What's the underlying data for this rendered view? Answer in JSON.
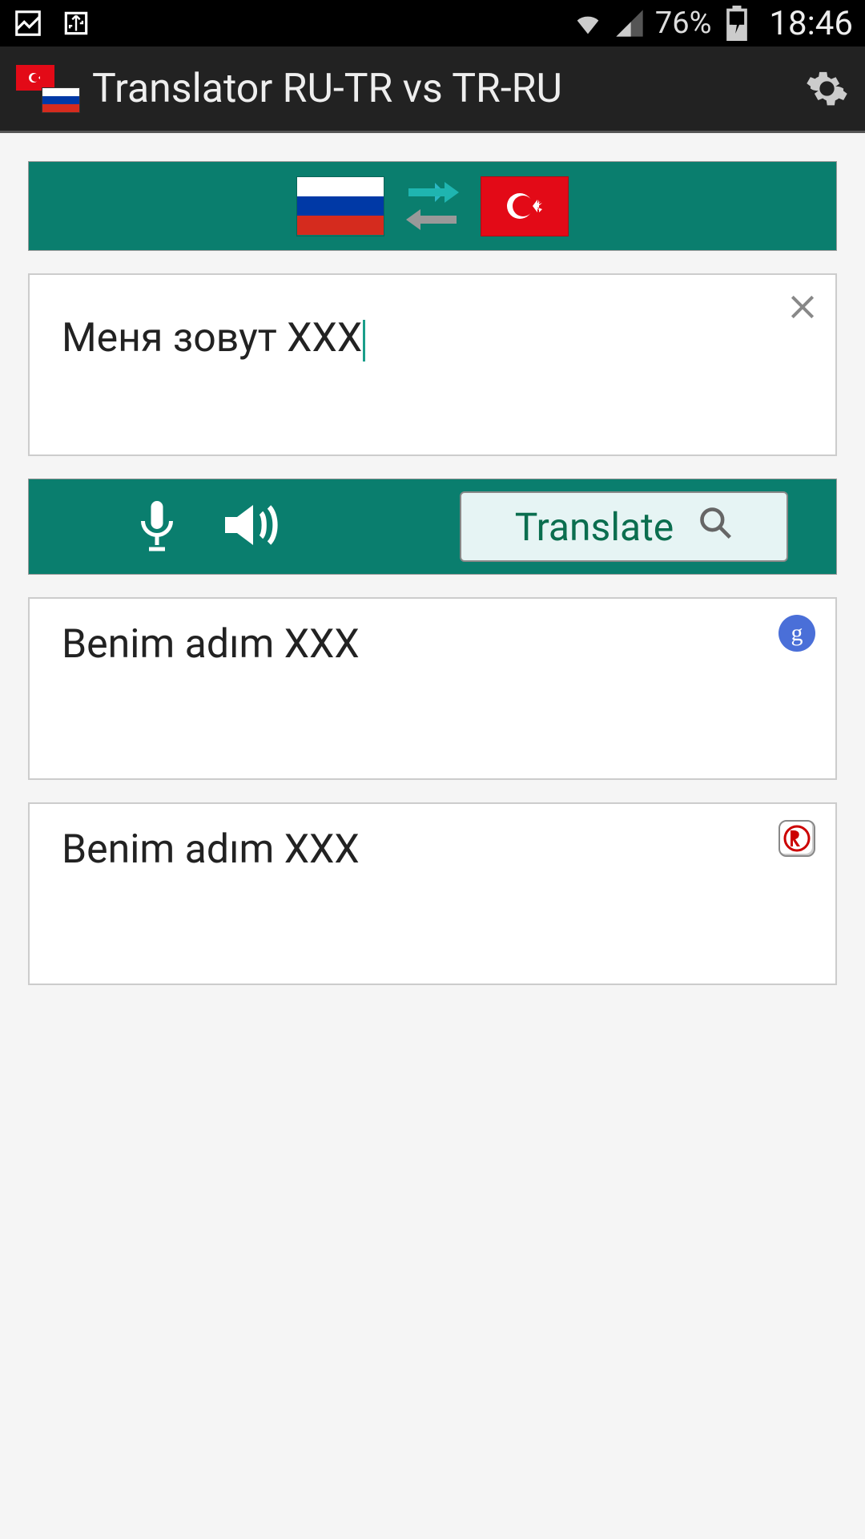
{
  "status": {
    "battery": "76%",
    "time": "18:46"
  },
  "app": {
    "title": "Translator RU-TR vs TR-RU"
  },
  "input": {
    "text": "Меня зовут XXX"
  },
  "actions": {
    "translate_label": "Translate"
  },
  "results": [
    {
      "text": "Benim adım XXX",
      "provider": "google"
    },
    {
      "text": "Benim adım XXX",
      "provider": "yandex"
    }
  ]
}
